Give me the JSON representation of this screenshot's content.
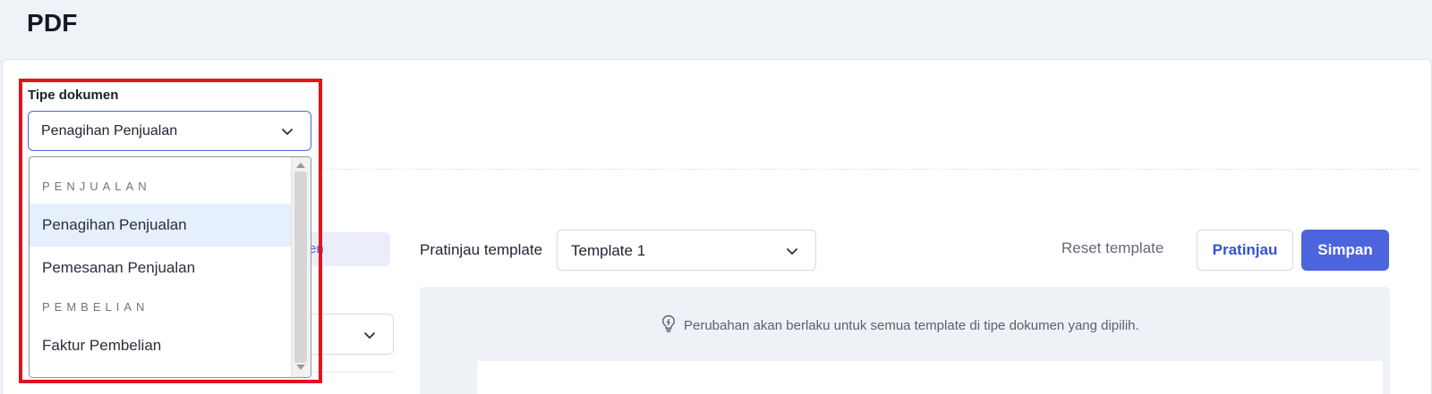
{
  "page": {
    "title": "PDF"
  },
  "doc_type": {
    "label": "Tipe dokumen",
    "selected": "Penagihan Penjualan",
    "groups": [
      {
        "name": "PENJUALAN",
        "items": [
          "Penagihan Penjualan",
          "Pemesanan Penjualan"
        ]
      },
      {
        "name": "PEMBELIAN",
        "items": [
          "Faktur Pembelian"
        ]
      }
    ]
  },
  "hidden_tab_fragment": "en",
  "toolbar": {
    "preview_label": "Pratinjau template",
    "template_value": "Template 1",
    "reset_label": "Reset template",
    "preview_button": "Pratinjau",
    "save_button": "Simpan"
  },
  "info": {
    "message": "Perubahan akan berlaku untuk semua template di tipe dokumen yang dipilih.",
    "icon": "lightbulb-icon"
  },
  "colors": {
    "accent": "#4c64dc",
    "highlight": "#e0141e",
    "selected_item": "#e6effc"
  }
}
